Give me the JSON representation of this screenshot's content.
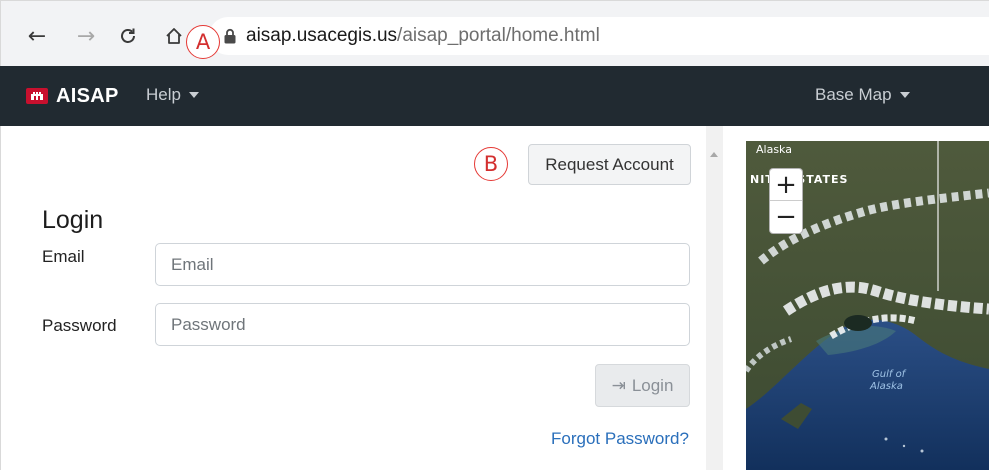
{
  "browser": {
    "back_icon": "back-arrow-icon",
    "forward_icon": "forward-arrow-icon",
    "reload_icon": "reload-icon",
    "home_icon": "home-icon",
    "lock_icon": "lock-icon",
    "url_host": "aisap.usacegis.us",
    "url_path": "/aisap_portal/home.html"
  },
  "callouts": {
    "a": "A",
    "b": "B"
  },
  "navbar": {
    "brand": "AISAP",
    "help_label": "Help",
    "base_map_label": "Base Map"
  },
  "login": {
    "request_account_label": "Request Account",
    "heading": "Login",
    "email_label": "Email",
    "email_placeholder": "Email",
    "email_value": "",
    "password_label": "Password",
    "password_placeholder": "Password",
    "password_value": "",
    "login_button_label": "Login",
    "forgot_password_label": "Forgot Password?"
  },
  "map": {
    "label_alaska": "Alaska",
    "label_country": "NITED STATES",
    "label_gulf_line1": "Gulf of",
    "label_gulf_line2": "Alaska",
    "zoom_in_label": "+",
    "zoom_out_label": "−"
  },
  "colors": {
    "navbar_bg": "#212a31",
    "brand_red": "#c8102e",
    "callout_red": "#e53935",
    "link_blue": "#2a6fbb"
  }
}
